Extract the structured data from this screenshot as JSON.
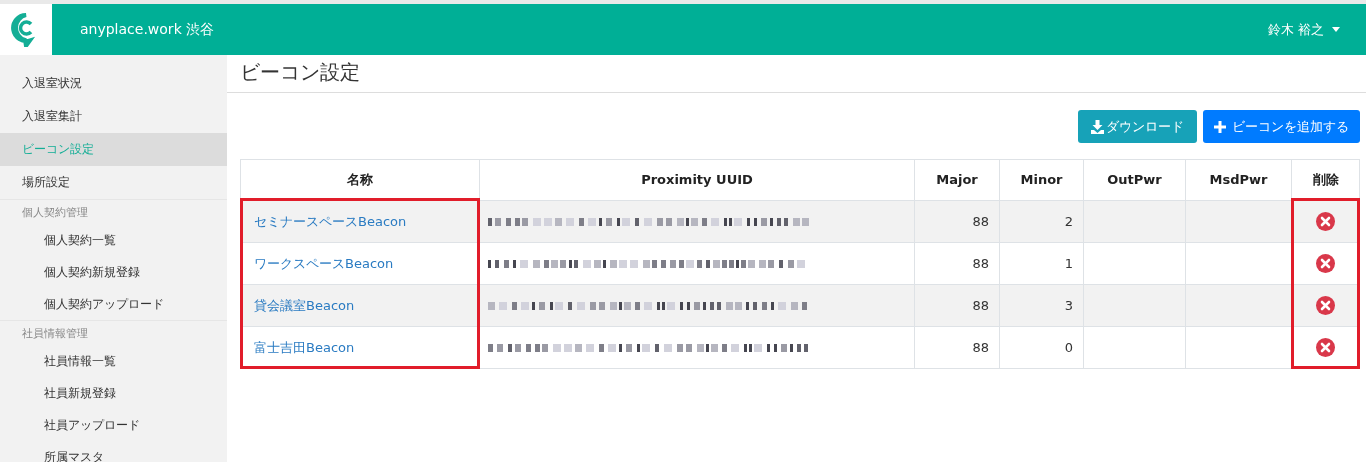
{
  "header": {
    "site": "anyplace.work 渋谷",
    "user": "鈴木 裕之"
  },
  "sidebar": {
    "items": [
      {
        "label": "入退室状況",
        "selected": false
      },
      {
        "label": "入退室集計",
        "selected": false
      },
      {
        "label": "ビーコン設定",
        "selected": true
      },
      {
        "label": "場所設定",
        "selected": false
      },
      {
        "label": "個人契約管理",
        "children": [
          {
            "label": "個人契約一覧",
            "selected": false
          },
          {
            "label": "個人契約新規登録",
            "selected": false
          },
          {
            "label": "個人契約アップロード",
            "selected": false
          }
        ]
      },
      {
        "label": "社員情報管理",
        "children": [
          {
            "label": "社員情報一覧",
            "selected": false
          },
          {
            "label": "社員新規登録",
            "selected": false
          },
          {
            "label": "社員アップロード",
            "selected": false
          },
          {
            "label": "所属マスタ",
            "selected": false
          }
        ]
      }
    ]
  },
  "page": {
    "title": "ビーコン設定"
  },
  "buttons": [
    {
      "kind": "download",
      "label": "ダウンロード"
    },
    {
      "kind": "add",
      "label": "ビーコンを追加する"
    }
  ],
  "table": {
    "columns": [
      {
        "label": "名称",
        "kind": "name",
        "highlight": true
      },
      {
        "label": "Proximity UUID",
        "kind": "uuid",
        "highlight": false
      },
      {
        "label": "Major",
        "kind": "number",
        "highlight": false
      },
      {
        "label": "Minor",
        "kind": "number",
        "highlight": false
      },
      {
        "label": "OutPwr",
        "kind": "number",
        "highlight": false
      },
      {
        "label": "MsdPwr",
        "kind": "number",
        "highlight": false
      },
      {
        "label": "削除",
        "kind": "delete",
        "highlight": true
      }
    ],
    "rows": [
      {
        "name": "セミナースペースBeacon",
        "major": "88",
        "minor": "2"
      },
      {
        "name": "ワークスペースBeacon",
        "major": "88",
        "minor": "1"
      },
      {
        "name": "貸会議室Beacon",
        "major": "88",
        "minor": "3"
      },
      {
        "name": "富士吉田Beacon",
        "major": "88",
        "minor": "0"
      }
    ]
  }
}
